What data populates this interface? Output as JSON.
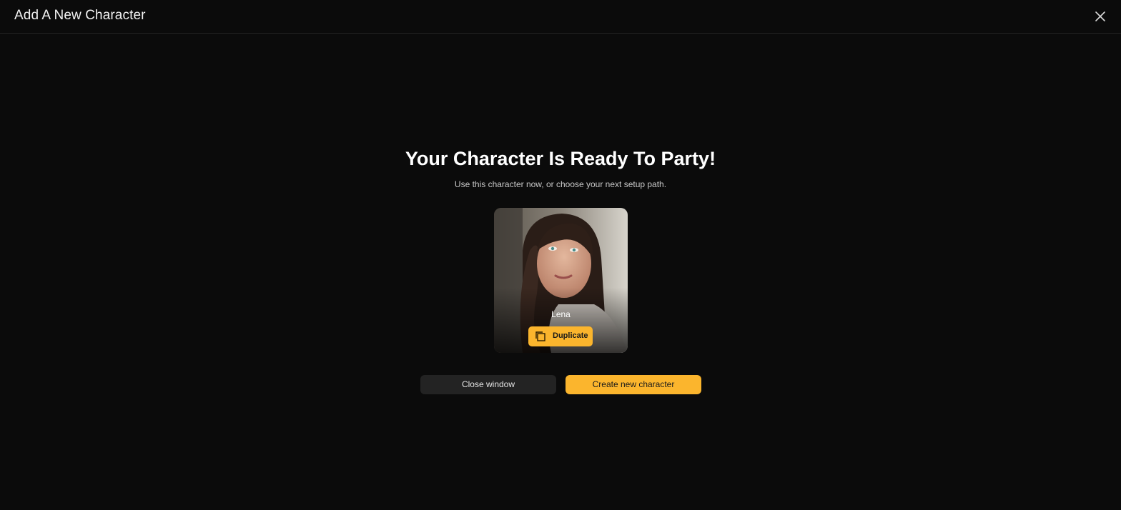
{
  "header": {
    "title": "Add A New Character",
    "close_icon": "close-icon"
  },
  "main": {
    "headline": "Your Character Is Ready To Party!",
    "subline": "Use this character now, or choose your next setup path."
  },
  "character_card": {
    "name": "Lena",
    "duplicate_label": "Duplicate",
    "duplicate_icon": "duplicate-icon"
  },
  "actions": {
    "close_label": "Close window",
    "create_label": "Create new character"
  },
  "colors": {
    "background": "#0b0b0b",
    "accent": "#fbb52d",
    "secondary_button": "#232323"
  }
}
